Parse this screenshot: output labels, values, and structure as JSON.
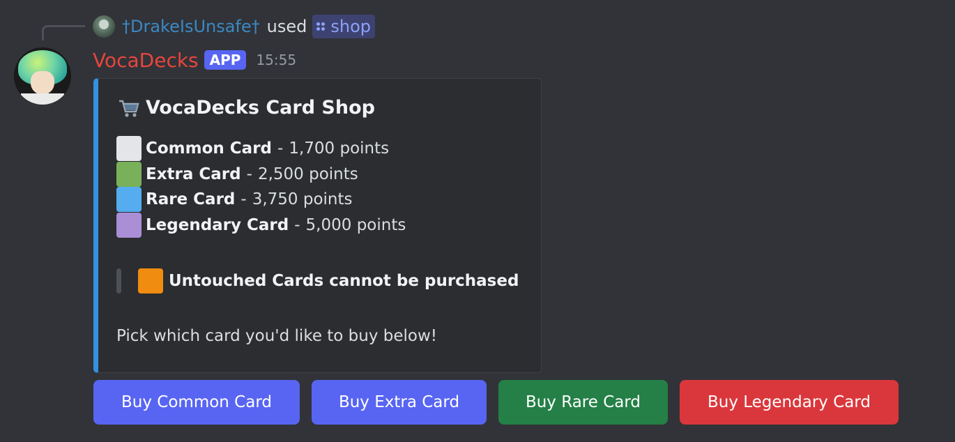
{
  "reply": {
    "username": "†DrakeIsUnsafe†",
    "used_text": "used",
    "command": "shop"
  },
  "message": {
    "bot_name": "VocaDecks",
    "badge": "APP",
    "timestamp": "15:55"
  },
  "embed": {
    "accent_color": "#3391e0",
    "title": "VocaDecks Card Shop",
    "title_icon": "shopping-cart-icon",
    "cards": [
      {
        "name": "Common Card",
        "price": "1,700 points",
        "color": "#e3e5e8"
      },
      {
        "name": "Extra Card",
        "price": "2,500 points",
        "color": "#78b159"
      },
      {
        "name": "Rare Card",
        "price": "3,750 points",
        "color": "#55acee"
      },
      {
        "name": "Legendary Card",
        "price": "5,000 points",
        "color": "#aa8ed6"
      }
    ],
    "separator": "-",
    "notice": {
      "text": "Untouched Cards cannot be purchased",
      "color": "#f4900c"
    },
    "footer": "Pick which card you'd like to buy below!"
  },
  "buttons": [
    {
      "label": "Buy Common Card",
      "style": "primary"
    },
    {
      "label": "Buy Extra Card",
      "style": "primary"
    },
    {
      "label": "Buy Rare Card",
      "style": "success"
    },
    {
      "label": "Buy Legendary Card",
      "style": "danger"
    }
  ]
}
